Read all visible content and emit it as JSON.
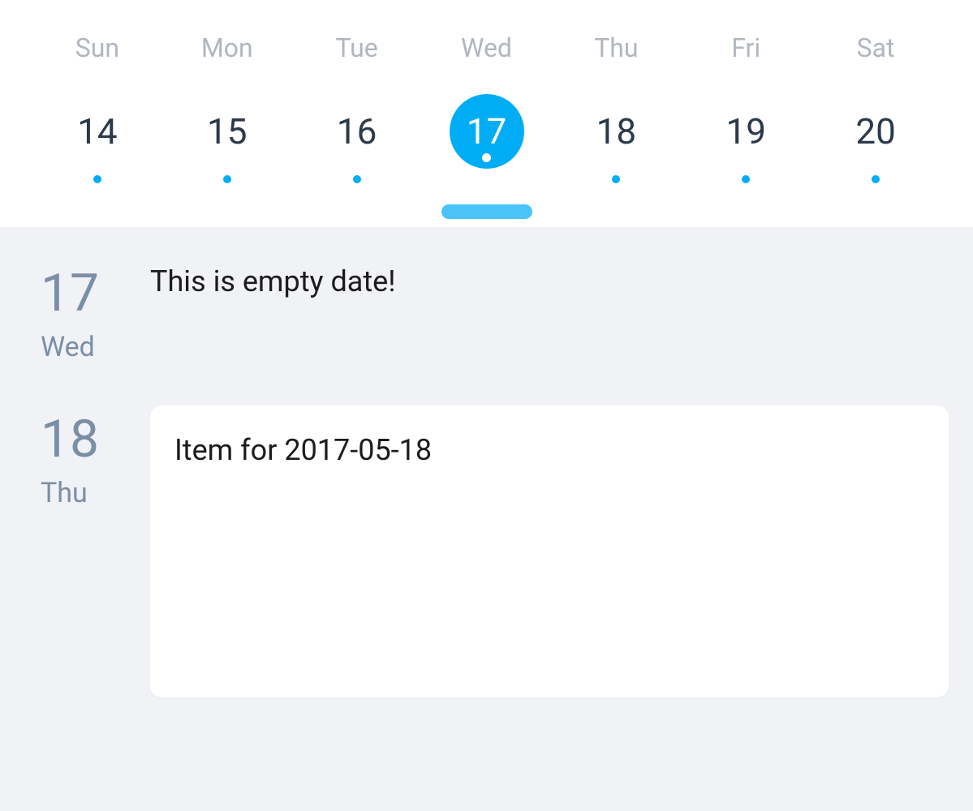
{
  "colors": {
    "accent": "#00adf5",
    "knob": "#4ac4f7",
    "muted": "#b0b6bf",
    "text": "#2b3a4a",
    "agendaDate": "#7a8fa6",
    "background": "#f1f2f6",
    "card": "#ffffff"
  },
  "week": {
    "days": [
      {
        "name": "Sun",
        "num": "14",
        "dot": true,
        "selected": false
      },
      {
        "name": "Mon",
        "num": "15",
        "dot": true,
        "selected": false
      },
      {
        "name": "Tue",
        "num": "16",
        "dot": true,
        "selected": false
      },
      {
        "name": "Wed",
        "num": "17",
        "dot": true,
        "selected": true
      },
      {
        "name": "Thu",
        "num": "18",
        "dot": true,
        "selected": false
      },
      {
        "name": "Fri",
        "num": "19",
        "dot": true,
        "selected": false
      },
      {
        "name": "Sat",
        "num": "20",
        "dot": true,
        "selected": false
      }
    ]
  },
  "agenda": [
    {
      "dateNum": "17",
      "dateWd": "Wed",
      "empty": true,
      "emptyText": "This is empty date!"
    },
    {
      "dateNum": "18",
      "dateWd": "Thu",
      "empty": false,
      "itemTitle": "Item for 2017-05-18"
    }
  ]
}
